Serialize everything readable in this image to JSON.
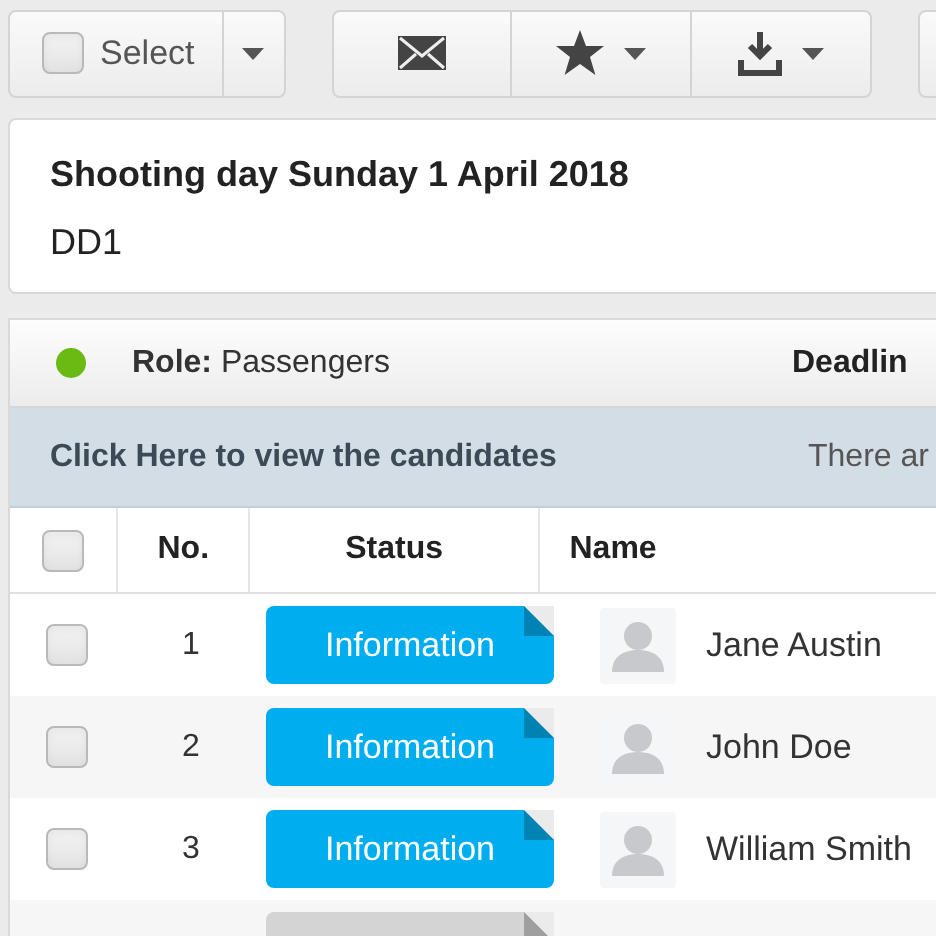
{
  "toolbar": {
    "select_label": "Select",
    "select_checked": false
  },
  "event": {
    "title": "Shooting day Sunday 1 April 2018",
    "code": "DD1"
  },
  "role": {
    "color": "#6bb913",
    "label": "Role:",
    "value": "Passengers",
    "deadline_label": "Deadlin"
  },
  "candidates_bar": {
    "link": "Click Here to view the candidates",
    "info": "There ar"
  },
  "table": {
    "columns": [
      "No.",
      "Status",
      "Name"
    ],
    "all_checked": false,
    "rows": [
      {
        "checked": false,
        "number": "1",
        "status": "Information",
        "color": "#00aeef",
        "name": "Jane Austin"
      },
      {
        "checked": false,
        "number": "2",
        "status": "Information",
        "color": "#00aeef",
        "name": "John Doe"
      },
      {
        "checked": false,
        "number": "3",
        "status": "Information",
        "color": "#00aeef",
        "name": "William Smith"
      },
      {
        "color": "#d4d4d4"
      }
    ]
  }
}
